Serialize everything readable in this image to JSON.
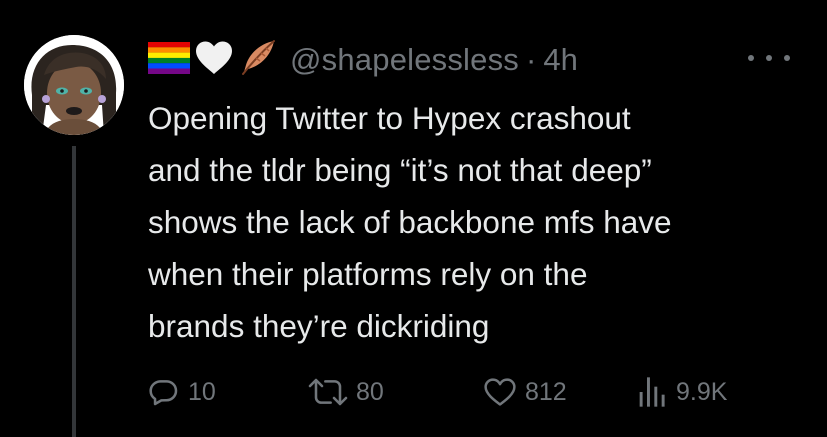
{
  "tweet": {
    "handle": "@shapelessless",
    "separator": "·",
    "time": "4h",
    "header_emojis": [
      "rainbow-flag-icon",
      "white-heart-icon",
      "feather-icon"
    ],
    "text_lines": [
      "Opening Twitter to Hypex crashout",
      "and the tldr being “it’s not that deep”",
      "shows the lack of backbone mfs have",
      "when their platforms rely on the",
      "brands they’re dickriding"
    ],
    "actions": {
      "replies": "10",
      "reposts": "80",
      "likes": "812",
      "views": "9.9K"
    }
  },
  "colors": {
    "background": "#000000",
    "text": "#e7e9ea",
    "secondary": "#71767b",
    "thread_line": "#333639"
  }
}
